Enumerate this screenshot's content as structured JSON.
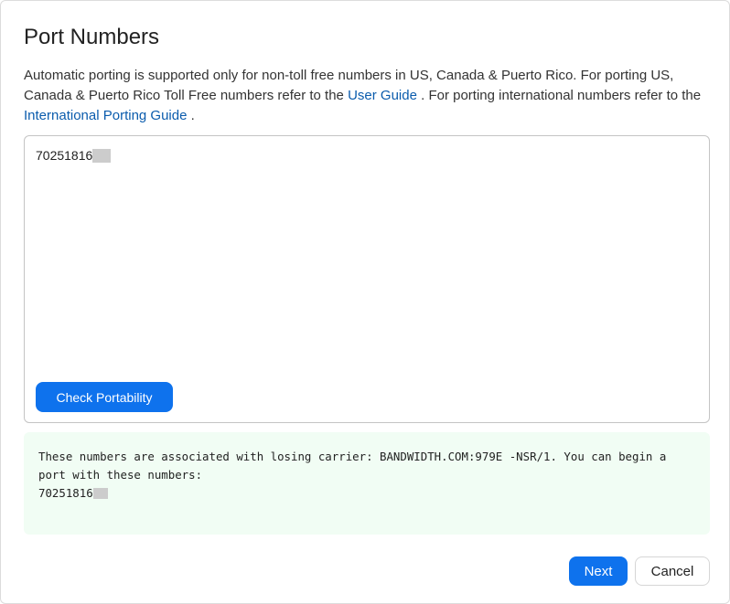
{
  "dialog": {
    "title": "Port Numbers",
    "intro": {
      "text_1": "Automatic porting is supported only for non-toll free numbers in US, Canada & Puerto Rico. For porting US, Canada & Puerto Rico Toll Free numbers refer to the ",
      "user_guide_link": "User Guide",
      "text_2": " . For porting international numbers refer to the ",
      "international_guide_link": "International Porting Guide",
      "text_3": " ."
    },
    "numbers_input": {
      "value": "70251816",
      "redacted_suffix": true
    },
    "check_button": "Check Portability",
    "result": {
      "message": "These numbers are associated with losing carrier: BANDWIDTH.COM:979E -NSR/1. You can begin a port with these numbers:",
      "number": "70251816",
      "background_color": "#f1fdf4"
    },
    "footer": {
      "next_label": "Next",
      "cancel_label": "Cancel"
    }
  },
  "colors": {
    "accent": "#0e72ed",
    "link": "#0b5cad",
    "redaction": "#cccccc"
  }
}
